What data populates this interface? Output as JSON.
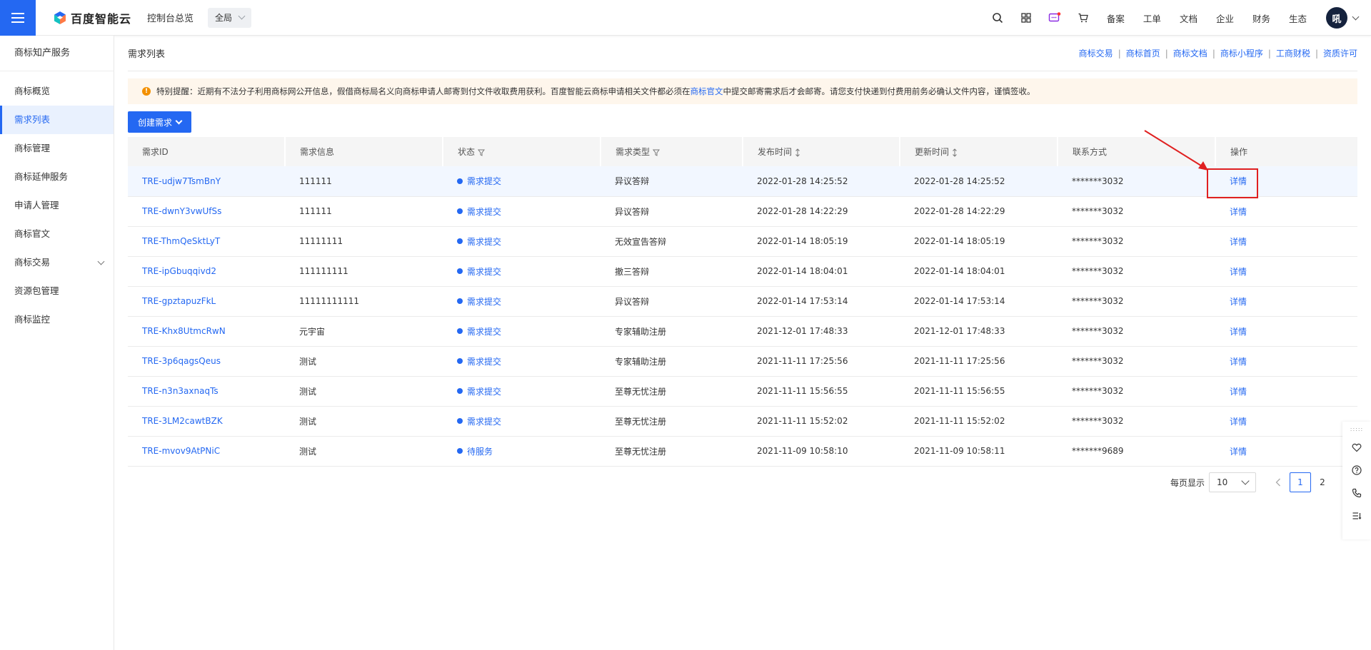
{
  "header": {
    "logo_text": "百度智能云",
    "console_link": "控制台总览",
    "region": "全局",
    "nav": [
      "备案",
      "工单",
      "文档",
      "企业",
      "财务",
      "生态"
    ],
    "avatar_text": "吼"
  },
  "sidebar": {
    "title": "商标知产服务",
    "items": [
      {
        "label": "商标概览"
      },
      {
        "label": "需求列表"
      },
      {
        "label": "商标管理"
      },
      {
        "label": "商标延伸服务"
      },
      {
        "label": "申请人管理"
      },
      {
        "label": "商标官文"
      },
      {
        "label": "商标交易"
      },
      {
        "label": "资源包管理"
      },
      {
        "label": "商标监控"
      }
    ]
  },
  "main": {
    "title": "需求列表",
    "quick_links": [
      "商标交易",
      "商标首页",
      "商标文档",
      "商标小程序",
      "工商财税",
      "资质许可"
    ],
    "notice": {
      "before": "特别提醒：近期有不法分子利用商标网公开信息，假借商标局名义向商标申请人邮寄到付文件收取费用获利。百度智能云商标申请相关文件都必须在",
      "link": "商标官文",
      "after": "中提交邮寄需求后才会邮寄。请您支付快递到付费用前务必确认文件内容，谨慎签收。"
    },
    "create_button": "创建需求"
  },
  "table": {
    "headers": [
      "需求ID",
      "需求信息",
      "状态",
      "需求类型",
      "发布时间",
      "更新时间",
      "联系方式",
      "操作"
    ],
    "rows": [
      {
        "id": "TRE-udjw7TsmBnY",
        "info": "111111",
        "status": "需求提交",
        "type": "异议答辩",
        "published": "2022-01-28 14:25:52",
        "updated": "2022-01-28 14:25:52",
        "contact": "*******3032",
        "action": "详情"
      },
      {
        "id": "TRE-dwnY3vwUfSs",
        "info": "111111",
        "status": "需求提交",
        "type": "异议答辩",
        "published": "2022-01-28 14:22:29",
        "updated": "2022-01-28 14:22:29",
        "contact": "*******3032",
        "action": "详情"
      },
      {
        "id": "TRE-ThmQeSktLyT",
        "info": "11111111",
        "status": "需求提交",
        "type": "无效宣告答辩",
        "published": "2022-01-14 18:05:19",
        "updated": "2022-01-14 18:05:19",
        "contact": "*******3032",
        "action": "详情"
      },
      {
        "id": "TRE-ipGbuqqivd2",
        "info": "111111111",
        "status": "需求提交",
        "type": "撤三答辩",
        "published": "2022-01-14 18:04:01",
        "updated": "2022-01-14 18:04:01",
        "contact": "*******3032",
        "action": "详情"
      },
      {
        "id": "TRE-gpztapuzFkL",
        "info": "11111111111",
        "status": "需求提交",
        "type": "异议答辩",
        "published": "2022-01-14 17:53:14",
        "updated": "2022-01-14 17:53:14",
        "contact": "*******3032",
        "action": "详情"
      },
      {
        "id": "TRE-Khx8UtmcRwN",
        "info": "元宇宙",
        "status": "需求提交",
        "type": "专家辅助注册",
        "published": "2021-12-01 17:48:33",
        "updated": "2021-12-01 17:48:33",
        "contact": "*******3032",
        "action": "详情"
      },
      {
        "id": "TRE-3p6qagsQeus",
        "info": "测试",
        "status": "需求提交",
        "type": "专家辅助注册",
        "published": "2021-11-11 17:25:56",
        "updated": "2021-11-11 17:25:56",
        "contact": "*******3032",
        "action": "详情"
      },
      {
        "id": "TRE-n3n3axnaqTs",
        "info": "测试",
        "status": "需求提交",
        "type": "至尊无忧注册",
        "published": "2021-11-11 15:56:55",
        "updated": "2021-11-11 15:56:55",
        "contact": "*******3032",
        "action": "详情"
      },
      {
        "id": "TRE-3LM2cawtBZK",
        "info": "测试",
        "status": "需求提交",
        "type": "至尊无忧注册",
        "published": "2021-11-11 15:52:02",
        "updated": "2021-11-11 15:52:02",
        "contact": "*******3032",
        "action": "详情"
      },
      {
        "id": "TRE-mvov9AtPNiC",
        "info": "测试",
        "status": "待服务",
        "type": "至尊无忧注册",
        "published": "2021-11-09 10:58:10",
        "updated": "2021-11-09 10:58:11",
        "contact": "*******9689",
        "action": "详情"
      }
    ]
  },
  "pagination": {
    "page_size_label": "每页显示",
    "page_size": "10",
    "pages": [
      "1",
      "2"
    ],
    "current": "1"
  },
  "colors": {
    "accent": "#2468f2",
    "highlight": "#e02020",
    "notice_bg": "#fef6ec",
    "warn": "#f39000"
  }
}
